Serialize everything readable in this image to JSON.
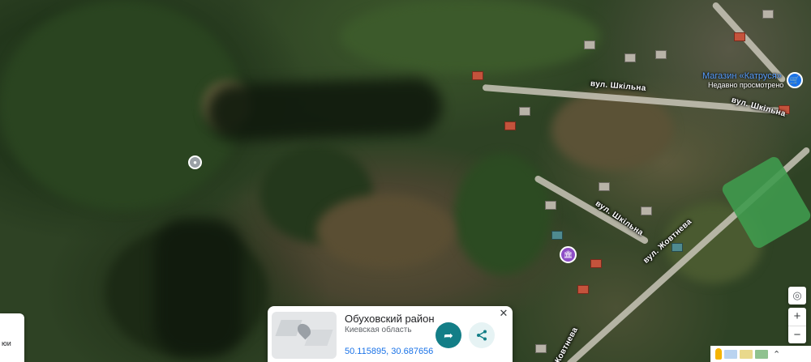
{
  "streets": {
    "shkilna_1": "вул. Шкільна",
    "shkilna_2": "вул. Шкільна",
    "shkilna_3": "вул. Шкільна",
    "zhovtneva_1": "вул. Жовтнева",
    "zhovtneva_2": "Жовтнева"
  },
  "pois": {
    "shop_name": "Магазин «Катруся»",
    "shop_status": "Недавно просмотрено"
  },
  "left_card": {
    "text": "юи"
  },
  "info_card": {
    "title": "Обуховский район",
    "subtitle": "Киевская область",
    "coordinates": "50.115895, 30.687656",
    "close_glyph": "✕",
    "directions_glyph": "➦",
    "share_glyph": "⟨"
  },
  "controls": {
    "locate_glyph": "◎",
    "zoom_in": "+",
    "zoom_out": "−",
    "expand_glyph": "⌃"
  },
  "icons": {
    "shop": "shopping-cart-icon",
    "museum": "museum-icon",
    "place": "place-marker-icon",
    "directions": "directions-icon",
    "share": "share-icon"
  },
  "colors": {
    "accent": "#1a73e8",
    "directions_button": "#137e87",
    "museum_pin": "#8e4ec6"
  }
}
